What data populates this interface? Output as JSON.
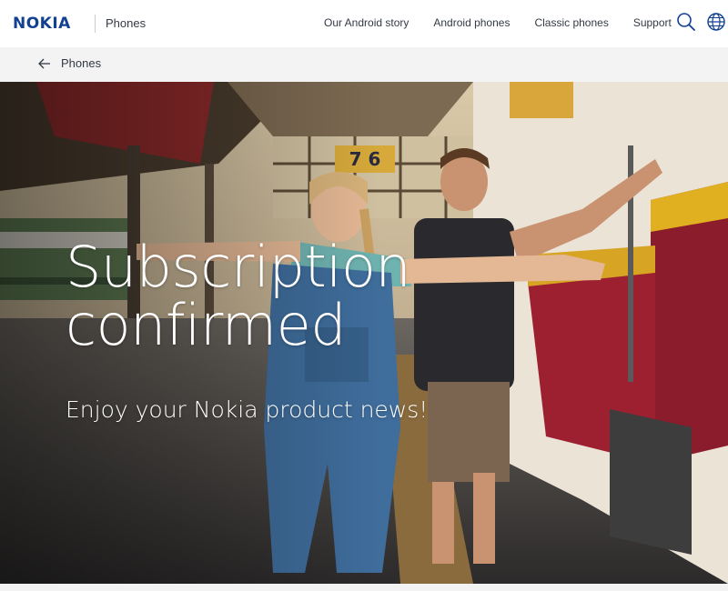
{
  "header": {
    "logo": "NOKIA",
    "section": "Phones",
    "nav": [
      {
        "label": "Our Android story"
      },
      {
        "label": "Android phones"
      },
      {
        "label": "Classic phones"
      },
      {
        "label": "Support"
      }
    ],
    "icons": [
      "search-icon",
      "globe-icon"
    ]
  },
  "breadcrumb": {
    "label": "Phones",
    "icon": "arrow-left-icon"
  },
  "hero": {
    "title_line1": "Subscription",
    "title_line2": "confirmed",
    "subtitle": "Enjoy your Nokia product news!",
    "platform_sign": "7 6"
  },
  "colors": {
    "brand_blue": "#124191",
    "breadcrumb_bg": "#f3f3f3",
    "train_red": "#8b1c2c",
    "train_yellow": "#e0b020"
  }
}
